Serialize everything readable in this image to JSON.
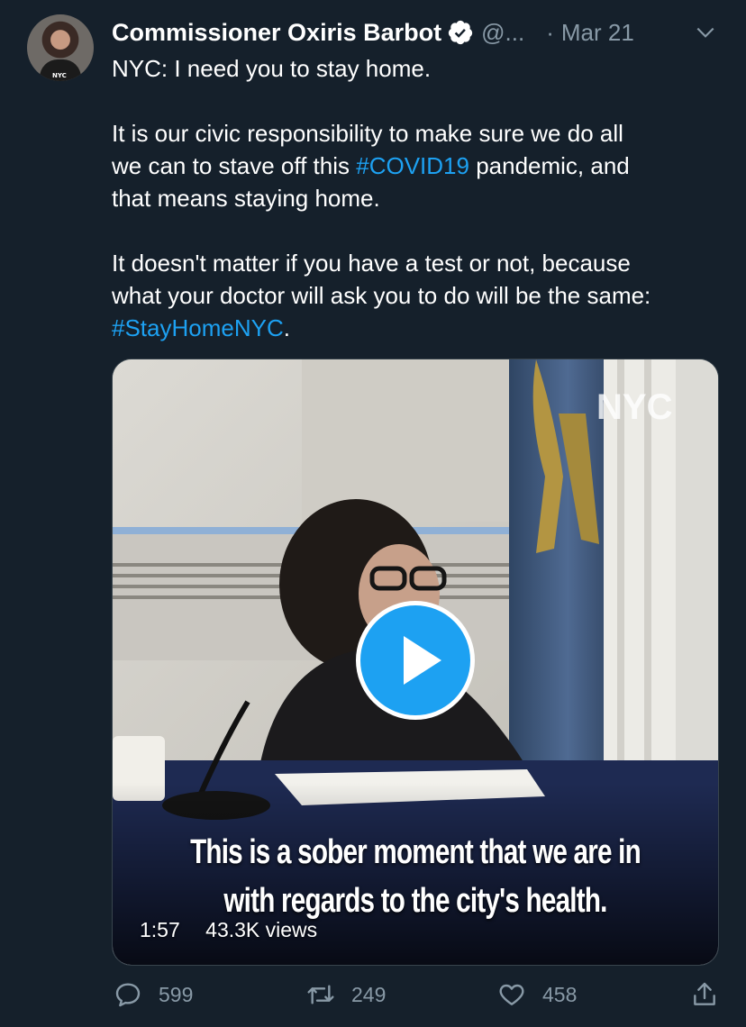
{
  "tweet": {
    "author_name": "Commissioner Oxiris Barbot",
    "handle": "@...",
    "separator": "·",
    "date": "Mar 21",
    "lines": [
      "NYC: I need you to stay home.",
      "It is our civic responsibility to make sure we do all",
      "we can to stave off this ",
      " pandemic, and",
      "that means staying home.",
      "It doesn't matter if you have a test or not, because",
      "what your doctor will ask you to do will be the same:",
      "."
    ],
    "hashtags": [
      "#COVID19",
      "#StayHomeNYC"
    ]
  },
  "avatar": {
    "logo_text": "NYC"
  },
  "video": {
    "watermark": "NYC",
    "caption_line1": "This is a sober moment that we are in",
    "caption_line2": "with regards to the city's health.",
    "duration": "1:57",
    "views": "43.3K views"
  },
  "actions": {
    "replies": "599",
    "retweets": "249",
    "likes": "458"
  },
  "colors": {
    "background": "#15202b",
    "accent": "#1da1f2",
    "secondary_text": "#8899a6"
  }
}
